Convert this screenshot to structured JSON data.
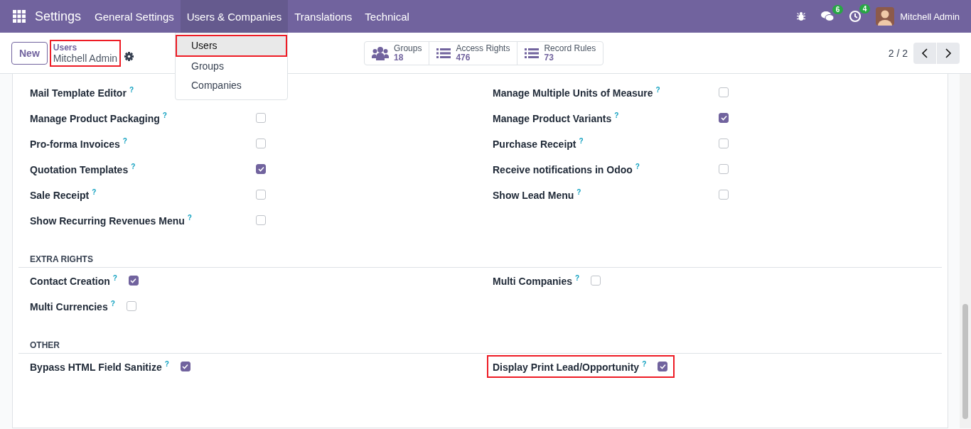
{
  "navbar": {
    "app_name": "Settings",
    "menus": [
      {
        "label": "General Settings",
        "selected": false
      },
      {
        "label": "Users & Companies",
        "selected": true
      },
      {
        "label": "Translations",
        "selected": false
      },
      {
        "label": "Technical",
        "selected": false
      }
    ],
    "badges": [
      {
        "kind": "chat",
        "count": "6"
      },
      {
        "kind": "activity",
        "count": "4"
      }
    ],
    "user_name": "Mitchell Admin"
  },
  "dropdown": {
    "items": [
      {
        "label": "Users",
        "selected": true,
        "highlighted": true
      },
      {
        "label": "Groups",
        "selected": false,
        "highlighted": false
      },
      {
        "label": "Companies",
        "selected": false,
        "highlighted": false
      }
    ]
  },
  "control_panel": {
    "new_button": "New",
    "breadcrumb": {
      "parent": "Users",
      "current": "Mitchell Admin",
      "highlighted": true
    },
    "smart_buttons": [
      {
        "kind": "groups",
        "label": "Groups",
        "count": "18"
      },
      {
        "kind": "list",
        "label": "Access Rights",
        "count": "476"
      },
      {
        "kind": "list",
        "label": "Record Rules",
        "count": "73"
      }
    ],
    "pager": "2 / 2"
  },
  "sections": [
    {
      "kind": "aligned",
      "columns": [
        [
          {
            "label": "Mail Template Editor",
            "help": "?"
          },
          {
            "label": "Manage Product Packaging",
            "help": "?",
            "checked": false
          },
          {
            "label": "Pro-forma Invoices",
            "help": "?",
            "checked": false
          },
          {
            "label": "Quotation Templates",
            "help": "?",
            "checked": true
          },
          {
            "label": "Sale Receipt",
            "help": "?",
            "checked": false
          },
          {
            "label": "Show Recurring Revenues Menu",
            "help": "?",
            "checked": false
          }
        ],
        [
          {
            "label": "Manage Multiple Units of Measure",
            "help": "?",
            "checked": false
          },
          {
            "label": "Manage Product Variants",
            "help": "?",
            "checked": true
          },
          {
            "label": "Purchase Receipt",
            "help": "?",
            "checked": false
          },
          {
            "label": "Receive notifications in Odoo",
            "help": "?",
            "checked": false
          },
          {
            "label": "Show Lead Menu",
            "help": "?",
            "checked": false
          }
        ]
      ]
    },
    {
      "kind": "inline",
      "title": "EXTRA RIGHTS",
      "columns": [
        [
          {
            "label": "Contact Creation",
            "help": "?",
            "checked": true
          },
          {
            "label": "Multi Currencies",
            "help": "?",
            "checked": false
          }
        ],
        [
          {
            "label": "Multi Companies",
            "help": "?",
            "checked": false
          }
        ]
      ]
    },
    {
      "kind": "inline",
      "title": "OTHER",
      "columns": [
        [
          {
            "label": "Bypass HTML Field Sanitize",
            "help": "?",
            "checked": true
          }
        ],
        [
          {
            "label": "Display Print Lead/Opportunity",
            "help": "?",
            "checked": true,
            "highlighted": true
          }
        ]
      ]
    }
  ]
}
